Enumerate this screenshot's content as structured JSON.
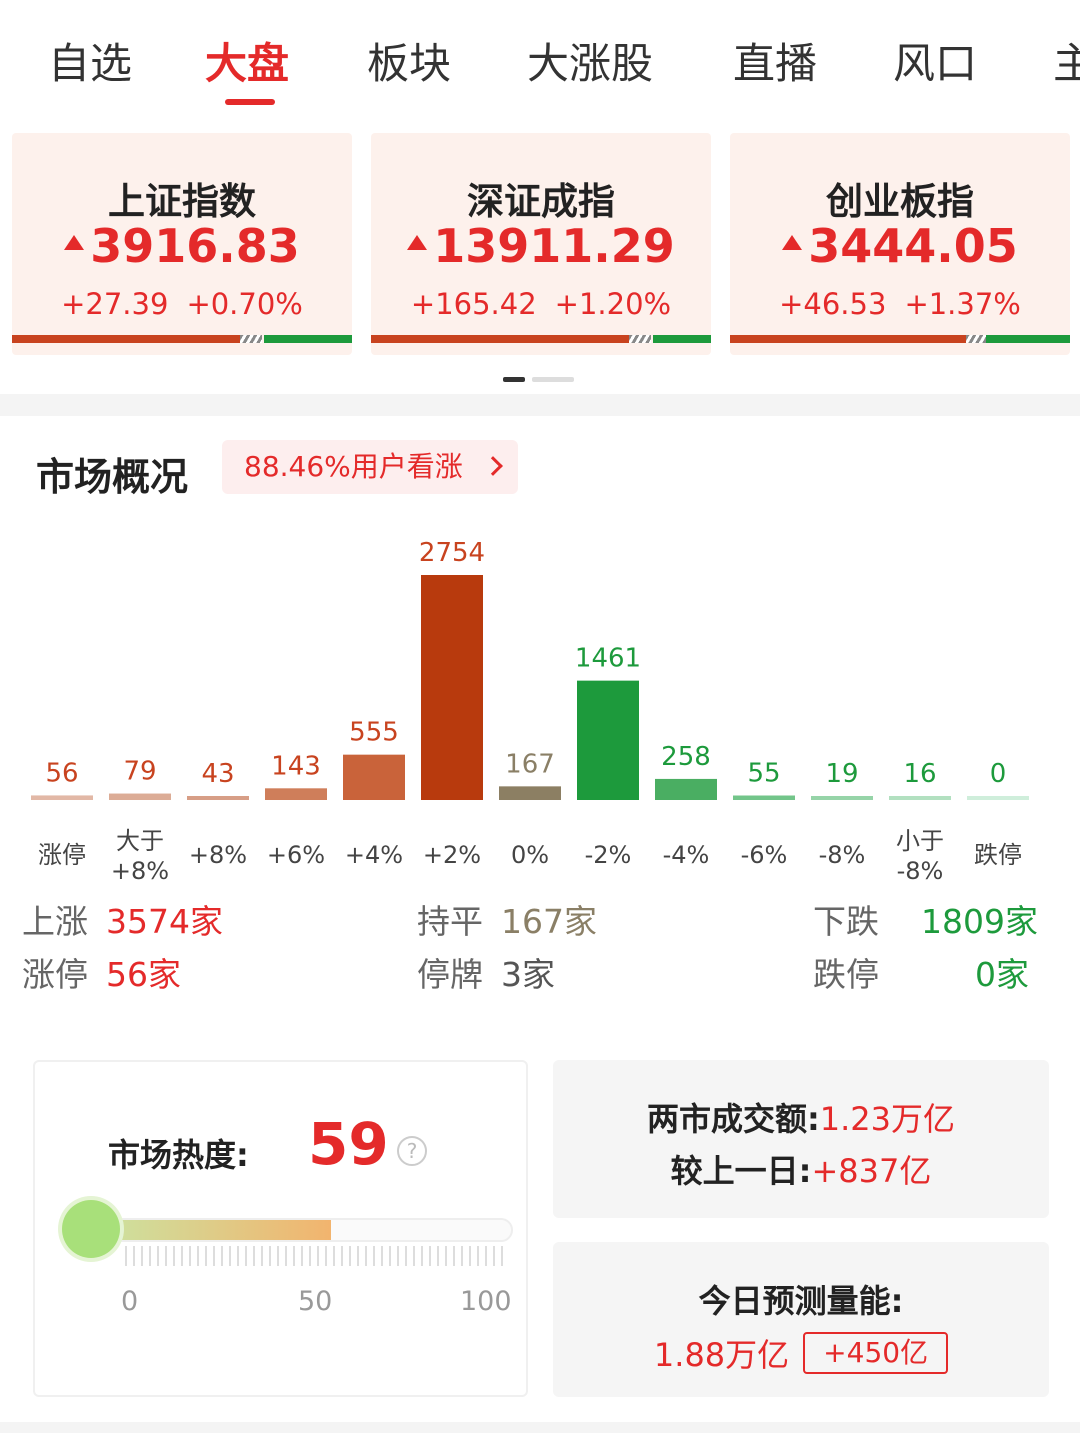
{
  "tabs": [
    {
      "label": "自选",
      "active": false
    },
    {
      "label": "大盘",
      "active": true
    },
    {
      "label": "板块",
      "active": false
    },
    {
      "label": "大涨股",
      "active": false
    },
    {
      "label": "直播",
      "active": false
    },
    {
      "label": "风口",
      "active": false
    },
    {
      "label": "主",
      "active": false
    }
  ],
  "indices": [
    {
      "name": "上证指数",
      "value": "3916.83",
      "change": "+27.39",
      "pct": "+0.70%"
    },
    {
      "name": "深证成指",
      "value": "13911.29",
      "change": "+165.42",
      "pct": "+1.20%"
    },
    {
      "name": "创业板指",
      "value": "3444.05",
      "change": "+46.53",
      "pct": "+1.37%"
    }
  ],
  "overview": {
    "title": "市场概况",
    "sentiment": "88.46%用户看涨"
  },
  "chart_data": {
    "type": "bar",
    "categories": [
      "涨停",
      "大于+8%",
      "+8%",
      "+6%",
      "+4%",
      "+2%",
      "0%",
      "-2%",
      "-4%",
      "-6%",
      "-8%",
      "小于-8%",
      "跌停"
    ],
    "values": [
      56,
      79,
      43,
      143,
      555,
      2754,
      167,
      1461,
      258,
      55,
      19,
      16,
      0
    ],
    "colors": [
      "#e2b8a6",
      "#dcac96",
      "#d79e86",
      "#cf7e5a",
      "#c9633a",
      "#b83a0d",
      "#8c7f63",
      "#1d9a3c",
      "#4aae62",
      "#73c58a",
      "#96d4a8",
      "#b2e0c0",
      "#cfeedb"
    ],
    "label_colors": [
      "#c8431f",
      "#c8431f",
      "#c8431f",
      "#c8431f",
      "#c8431f",
      "#c8431f",
      "#8a7f66",
      "#1d9a3c",
      "#1d9a3c",
      "#1d9a3c",
      "#1d9a3c",
      "#1d9a3c",
      "#1d9a3c"
    ],
    "ylim": [
      0,
      2754
    ]
  },
  "stats": {
    "up_label": "上涨",
    "up_value": "3574家",
    "flat_label": "持平",
    "flat_value": "167家",
    "down_label": "下跌",
    "down_value": "1809家",
    "limit_up_label": "涨停",
    "limit_up_value": "56家",
    "suspended_label": "停牌",
    "suspended_value": "3家",
    "limit_down_label": "跌停",
    "limit_down_value": "0家"
  },
  "heat": {
    "label": "市场热度:",
    "value": 59,
    "value_text": "59",
    "help": "?",
    "axis": [
      "0",
      "50",
      "100"
    ]
  },
  "turnover": {
    "label": "两市成交额:",
    "value": "1.23万亿",
    "compare_label": "较上一日:",
    "compare_value": "+837亿"
  },
  "forecast": {
    "label": "今日预测量能:",
    "value": "1.88万亿",
    "badge": "+450亿"
  },
  "colors": {
    "up": "#e42a2a",
    "down": "#1d9a3c",
    "flat": "#8a7f66"
  }
}
